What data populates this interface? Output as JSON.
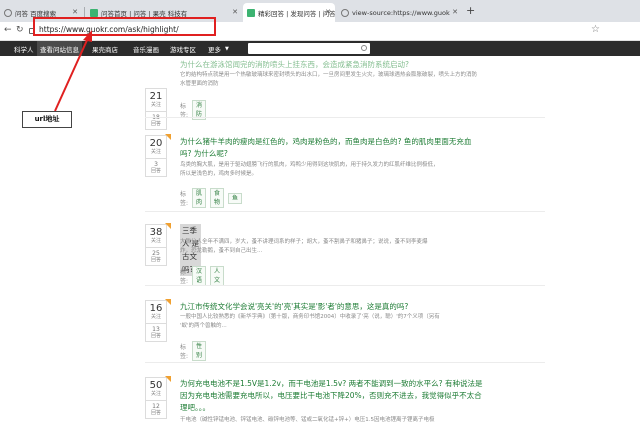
{
  "browser": {
    "tabs": [
      {
        "label": "问答 百度搜索",
        "icon": "globe-icon"
      },
      {
        "label": "问答首页 | 问答 | 果壳 科技有",
        "icon": "guokr-icon"
      },
      {
        "label": "精彩回答 | 发现问答 | 问答 | 果",
        "icon": "guokr-icon"
      },
      {
        "label": "view-source:https://www.guok",
        "icon": "globe-icon"
      }
    ],
    "url": "https://www.guokr.com/ask/highlight/"
  },
  "site_nav": {
    "items": [
      "科学人",
      "查看问站信息",
      "果壳商店",
      "音乐漫画",
      "游戏专区",
      "更多"
    ]
  },
  "annotation": {
    "label": "url地址",
    "color": "#e02020"
  },
  "questions": [
    {
      "votes": "21",
      "votes_label": "关注",
      "answers": "18",
      "answers_label": "回答",
      "title": "为什么在游泳馆闻完的消防喷头上挂东西，会造成紧急消防系统启动?",
      "summary": "它的结构特点就是用一个热敏玻璃球来密封喷头的出水口，一旦房间里发生火灾，玻璃球遇热会膨胀破裂，喷头上方的消防水管里面的消防",
      "tags_label": "标签:",
      "tags": [
        "消防"
      ]
    },
    {
      "votes": "20",
      "votes_label": "关注",
      "answers": "3",
      "answers_label": "回答",
      "title_lines": [
        "为什么猪牛羊肉的瘦肉是红色的，鸡肉是粉色的，而鱼肉是白色的? 鱼的肌肉里面无充血",
        "吗? 为什么呢?"
      ],
      "summary_lines": [
        "鸟类的胸大肌，是用于驱动翅膀飞行的肌肉，鸡鸭少用得到这块肌肉，用于持久发力的红肌纤维比例极低，",
        "所以是浅色的，鸡肉多时候是。"
      ],
      "tags_label": "标签:",
      "tags": [
        "肌肉",
        "食物",
        "鱼"
      ]
    },
    {
      "votes": "38",
      "votes_label": "关注",
      "answers": "25",
      "answers_label": "回答",
      "title": "三季人'是古文吗?",
      "summary_lines": [
        "大脱分人全年不满四，岁大，蚤不讲理词系的样子；胡大，蚤不割鼻子和猪鼻子；说说，蚤不到李麦爆",
        "炸，恐龙勒鹅，蚤不到自己出生..."
      ],
      "tags_label": "标签:",
      "tags": [
        "汉语",
        "人文"
      ]
    },
    {
      "votes": "16",
      "votes_label": "关注",
      "answers": "13",
      "answers_label": "回答",
      "title": "九江市传统文化学会说'亮关'的'亮'其实是'影'者'的意思，这是真的吗?",
      "summary_lines": [
        "一般中国人比较熟悉的《新华字典》（第十版，商务印书馆2004）中收录了'亮（说，聪）'的7个义项（另有",
        "'蚁'的两个兽触的..."
      ],
      "tags_label": "标签:",
      "tags": [
        "性别"
      ]
    },
    {
      "votes": "50",
      "votes_label": "关注",
      "answers": "12",
      "answers_label": "回答",
      "title_lines": [
        "为何充电电池不是1.5V是1.2v，而干电池是1.5v? 两者不能调到一致的水平么? 有种说法是",
        "因为充电电池需要充电所以，电压要比干电池下降20%，否则充不进去，我觉得似乎不太合",
        "理吧。。。"
      ],
      "summary": "干电池（碱性锌锰电池、锌锰电池、碳锌电池等、锰或二氧化锰+锌+）电压1.5因电池锂离子锂离子电极"
    }
  ]
}
